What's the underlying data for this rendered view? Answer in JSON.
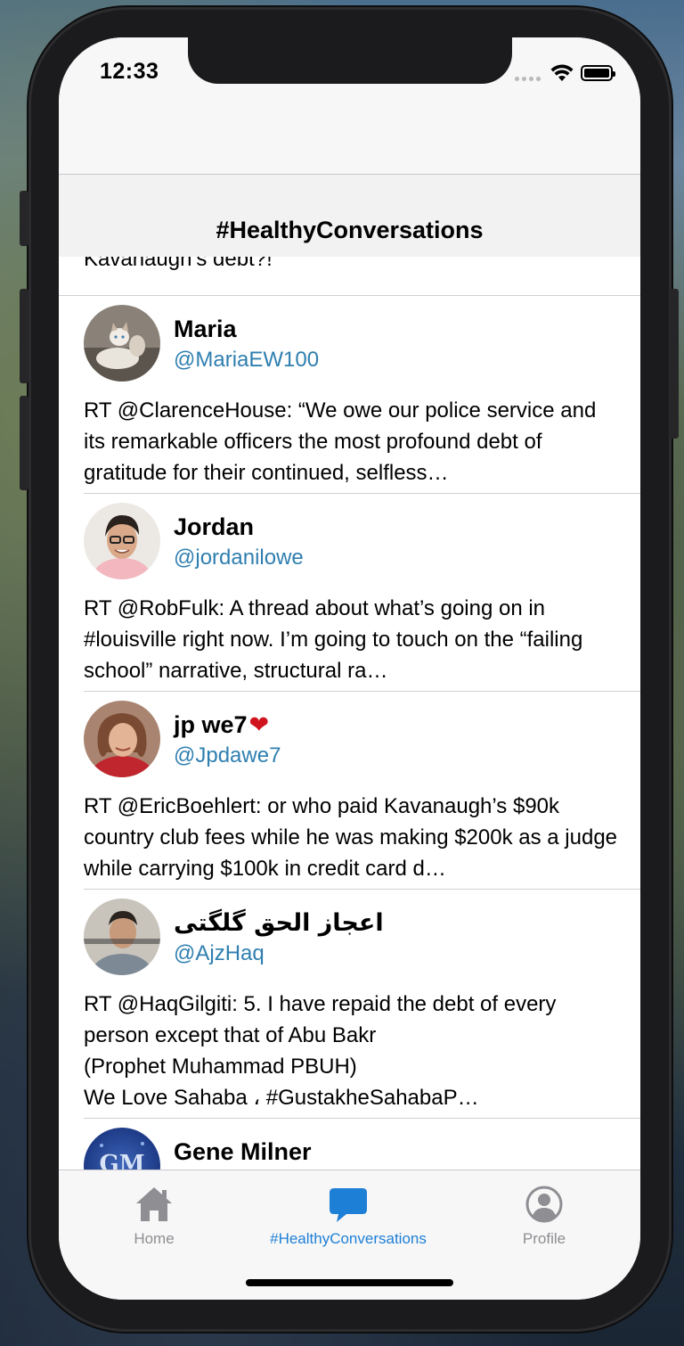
{
  "status_bar": {
    "time": "12:33"
  },
  "nav": {
    "title": "#HealthyConversations"
  },
  "feed": {
    "partial_text": "Kavanaugh’s debt?!",
    "tweets": [
      {
        "name": "Maria",
        "handle": "@MariaEW100",
        "text": "RT @ClarenceHouse: “We owe our police service and its remarkable officers the most profound debt of gratitude for their continued, selfless…",
        "avatar": "cat-avatar"
      },
      {
        "name": "Jordan",
        "handle": "@jordanilowe",
        "text": "RT @RobFulk: A thread about what’s going on in #louisville right now.   I’m going to touch on the “failing school” narrative, structural ra…",
        "avatar": "person-avatar"
      },
      {
        "name": "jp we7",
        "name_emoji": "❤️",
        "handle": "@Jpdawe7",
        "text": "RT @EricBoehlert: or who paid Kavanaugh’s $90k country club fees while he was making $200k as a judge while carrying $100k in credit card d…",
        "avatar": "person-avatar"
      },
      {
        "name": "اعجاز الحق گلگتی",
        "handle": "@AjzHaq",
        "text": "RT @HaqGilgiti: 5. I have repaid the debt of every person except that of Abu Bakr\n(Prophet Muhammad PBUH)\nWe Love Sahaba ، #GustakheSahabaP…",
        "avatar": "person-avatar"
      },
      {
        "name": "Gene Milner",
        "avatar_initials": "GM",
        "avatar": "initials-avatar"
      }
    ]
  },
  "tabbar": {
    "items": [
      {
        "label": "Home",
        "icon": "home-icon",
        "active": false
      },
      {
        "label": "#HealthyConversations",
        "icon": "chat-bubble-icon",
        "active": true
      },
      {
        "label": "Profile",
        "icon": "profile-icon",
        "active": false
      }
    ]
  },
  "colors": {
    "accent": "#1e7fd6",
    "handle": "#2f7fb0",
    "inactive_tab": "#8e8e93"
  }
}
